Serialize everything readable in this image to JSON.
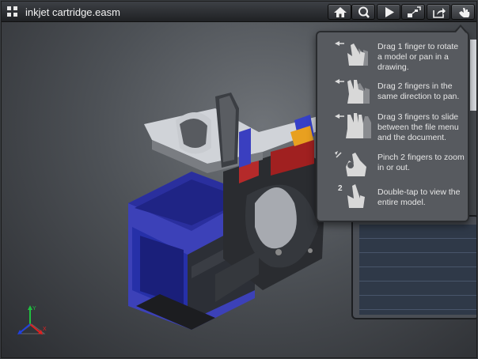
{
  "window": {
    "title": "inkjet cartridge.easm"
  },
  "toolbar": {
    "buttons": [
      {
        "name": "home",
        "icon": "home-icon"
      },
      {
        "name": "zoom",
        "icon": "magnifier-icon"
      },
      {
        "name": "play",
        "icon": "play-icon"
      },
      {
        "name": "explode",
        "icon": "explode-icon"
      },
      {
        "name": "share",
        "icon": "share-icon"
      },
      {
        "name": "gestures",
        "icon": "hand-gesture-icon"
      }
    ]
  },
  "help": {
    "items": [
      {
        "icon": "one-finger-drag-icon",
        "text": "Drag 1 finger to rotate a model or pan in a drawing."
      },
      {
        "icon": "two-finger-drag-icon",
        "text": "Drag 2 fingers in the same direction to pan."
      },
      {
        "icon": "three-finger-drag-icon",
        "text": "Drag 3 fingers to slide between the file menu and the document."
      },
      {
        "icon": "pinch-icon",
        "text": "Pinch 2 fingers to zoom in or out."
      },
      {
        "icon": "double-tap-icon",
        "badge": "2",
        "text": "Double-tap to view the entire model."
      }
    ]
  },
  "axes": {
    "x": "X",
    "y": "Y"
  },
  "colors": {
    "model_blue": "#2a2fa0",
    "model_dark": "#26282b",
    "model_red": "#a02020",
    "model_yellow": "#e8a020"
  }
}
